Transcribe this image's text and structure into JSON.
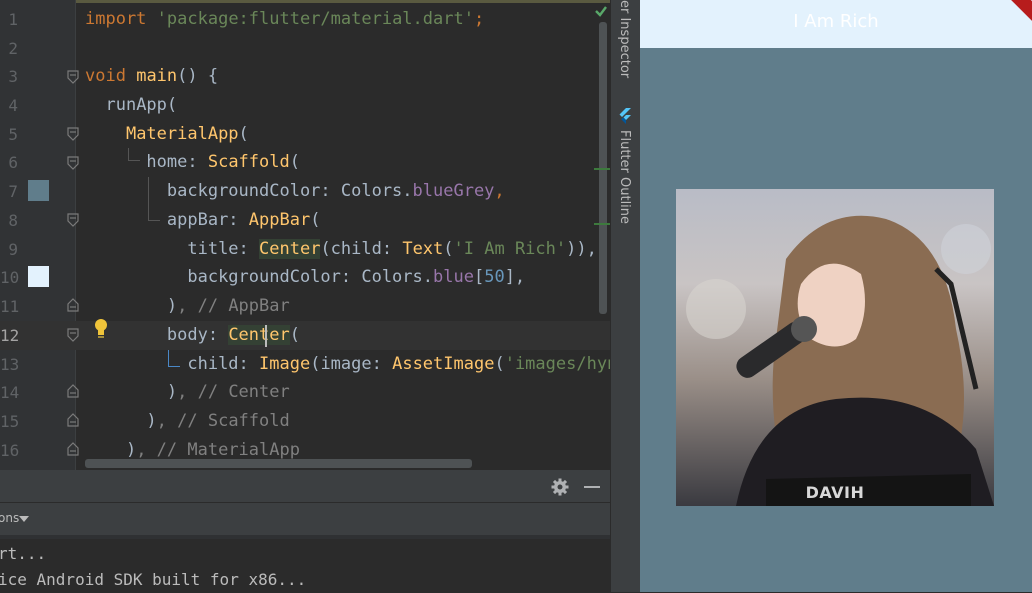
{
  "editor": {
    "lines": [
      {
        "n": "1"
      },
      {
        "n": "2"
      },
      {
        "n": "3"
      },
      {
        "n": "4"
      },
      {
        "n": "5"
      },
      {
        "n": "6"
      },
      {
        "n": "7"
      },
      {
        "n": "8"
      },
      {
        "n": "9"
      },
      {
        "n": "10"
      },
      {
        "n": "11"
      },
      {
        "n": "12"
      },
      {
        "n": "13"
      },
      {
        "n": "14"
      },
      {
        "n": "15"
      },
      {
        "n": "16"
      }
    ],
    "code": {
      "l1_import": "import",
      "l1_pkg": "'package:flutter/material.dart'",
      "l1_semi": ";",
      "l3_void": "void",
      "l3_main": "main",
      "l3_rest": "() {",
      "l4": "runApp(",
      "l5_cls": "MaterialApp",
      "l5_paren": "(",
      "l6_key": "home: ",
      "l6_cls": "Scaffold",
      "l6_paren": "(",
      "l7_key": "backgroundColor: Colors.",
      "l7_val": "blueGrey",
      "l7_comma": ",",
      "l8_key": "appBar: ",
      "l8_cls": "AppBar",
      "l8_paren": "(",
      "l9_key": "title: ",
      "l9_center": "Center",
      "l9_mid": "(child: ",
      "l9_text": "Text",
      "l9_paren": "(",
      "l9_str": "'I Am Rich'",
      "l9_end": ")),",
      "l10_key": "backgroundColor: Colors.",
      "l10_prop": "blue",
      "l10_open": "[",
      "l10_num": "50",
      "l10_close": "],",
      "l11_paren": ")",
      "l11_cmt": ", // AppBar",
      "l12_key": "body: ",
      "l12_a": "Cent",
      "l12_b": "er",
      "l12_paren": "(",
      "l13_key": "child: ",
      "l13_img": "Image",
      "l13_mid": "(image: ",
      "l13_asset": "AssetImage",
      "l13_paren": "(",
      "l13_str": "'images/hynn",
      "l14_paren": ")",
      "l14_cmt": ", // Center",
      "l15_paren": ")",
      "l15_cmt": ", // Scaffold",
      "l16_paren": ")",
      "l16_cmt": ", // MaterialApp"
    },
    "swatch_colors": {
      "line7": "#607d8b",
      "line10": "#e3f2fd"
    }
  },
  "panel": {
    "toolbar_label": "ons",
    "console_lines": [
      "rt...",
      "ice Android SDK built for x86..."
    ]
  },
  "strip": {
    "tab_inspector": "er Inspector",
    "tab_outline": "Flutter Outline"
  },
  "app": {
    "title": "I Am Rich",
    "appbar_color": "#e3f2fd",
    "background_color": "#607d8b",
    "photo_caption": "DAVIH"
  },
  "icons": {
    "fold": "fold-marker-icon",
    "bulb": "lightbulb-icon",
    "check": "check-icon",
    "gear": "gear-icon",
    "minimize": "minimize-icon",
    "dropdown": "dropdown-arrow-icon",
    "flutter": "flutter-icon"
  }
}
